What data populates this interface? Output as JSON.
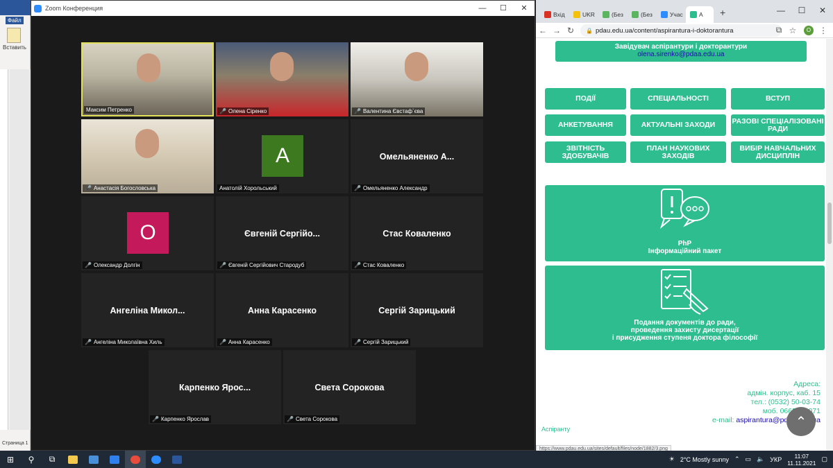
{
  "word": {
    "file_label": "Файл",
    "insert_label": "Вставить",
    "status": "Страница 1"
  },
  "zoom": {
    "title": "Zoom Конференция",
    "participants": [
      {
        "display": "",
        "label": "Максим Петренко",
        "muted": false,
        "video": true,
        "active": true
      },
      {
        "display": "",
        "label": "Олена Сіренко",
        "muted": true,
        "video": true
      },
      {
        "display": "",
        "label": "Валентина Євстаф`єва",
        "muted": true,
        "video": true
      },
      {
        "display": "",
        "label": "Анастасія Богословська",
        "muted": true,
        "video": true
      },
      {
        "display": "A",
        "label": "Анатолій Хорольський",
        "muted": false,
        "avatar_color": "#3d7a1f"
      },
      {
        "display": "Омельяненко  А...",
        "label": "Омельяненко Александр",
        "muted": true
      },
      {
        "display": "O",
        "label": "Олександр Долгін",
        "muted": true,
        "avatar_color": "#c41a5b"
      },
      {
        "display": "Євгеній Сергійо...",
        "label": "Євгеній Сергійович Стародуб",
        "muted": true
      },
      {
        "display": "Стас Коваленко",
        "label": "Стас Коваленко",
        "muted": true
      },
      {
        "display": "Ангеліна  Микол...",
        "label": "Ангеліна Миколаївна Хиль",
        "muted": true
      },
      {
        "display": "Анна Карасенко",
        "label": "Анна Карасенко",
        "muted": true
      },
      {
        "display": "Сергій Зарицький",
        "label": "Сергій Зарицький",
        "muted": true
      },
      {
        "display": "Карпенко  Ярос...",
        "label": "Карпенко Ярослав",
        "muted": true
      },
      {
        "display": "Света Сорокова",
        "label": "Света Сорокова",
        "muted": true
      }
    ]
  },
  "chrome": {
    "tabs": [
      {
        "label": "Вхід",
        "color": "#d93025"
      },
      {
        "label": "UKR",
        "color": "#f4c20d"
      },
      {
        "label": "(Без",
        "color": "#5ab55e"
      },
      {
        "label": "(Без",
        "color": "#5ab55e"
      },
      {
        "label": "Учас",
        "color": "#2d8cff"
      },
      {
        "label": "А",
        "color": "#2ebd8f"
      }
    ],
    "url": "pdau.edu.ua/content/aspirantura-i-doktorantura",
    "profile_letter": "O",
    "header": {
      "title": "Завідувач аспірантури і докторантури",
      "email": "olena.sirenko@pdaa.edu.ua"
    },
    "buttons": [
      "Події",
      "Спеціальності",
      "Вступ",
      "Анкетування",
      "Актуальні заходи",
      "Разові спеціалізовані ради",
      "Звітність здобувачів",
      "План наукових заходів",
      "Вибір навчальних дисциплін"
    ],
    "card1": {
      "line1": "PhP",
      "line2": "Інформаційний пакет"
    },
    "card2": {
      "line1": "Подання документів до ради,",
      "line2": "проведення захисту дисертації",
      "line3": "і присудження ступеня доктора філософії"
    },
    "address": {
      "label": "Адреса:",
      "line1": "адмін. корпус, каб. 15",
      "phone": "тел.: (0532) 50-03-74",
      "mobile": "моб. 0665786071",
      "email_label": "e-mail:",
      "email": "aspirantura@pdaa.edu.ua"
    },
    "footer_link": "Аспіранту",
    "status_url": "https://www.pdau.edu.ua/sites/default/files/node/1882/3.png"
  },
  "taskbar": {
    "weather": "2°C  Mostly sunny",
    "lang": "УКР",
    "time": "11:07",
    "date": "11.11.2021"
  }
}
